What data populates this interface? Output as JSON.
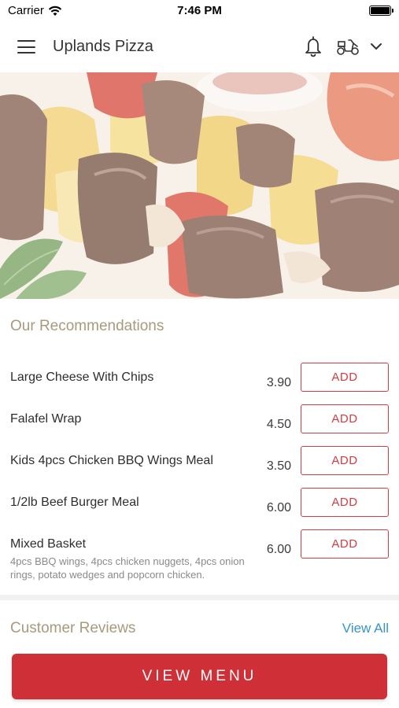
{
  "status_bar": {
    "carrier": "Carrier",
    "time": "7:46 PM"
  },
  "header": {
    "title": "Uplands Pizza",
    "icons": [
      "menu-icon",
      "bell-icon",
      "scooter-icon",
      "chevron-down-icon"
    ]
  },
  "recommendations": {
    "title": "Our Recommendations",
    "add_label": "ADD",
    "items": [
      {
        "name": "Large Cheese With Chips",
        "price": "3.90",
        "description": ""
      },
      {
        "name": "Falafel Wrap",
        "price": "4.50",
        "description": ""
      },
      {
        "name": "Kids 4pcs Chicken BBQ Wings Meal",
        "price": "3.50",
        "description": ""
      },
      {
        "name": "1/2lb Beef Burger Meal",
        "price": "6.00",
        "description": ""
      },
      {
        "name": "Mixed Basket",
        "price": "6.00",
        "description": "4pcs BBQ wings, 4pcs chicken nuggets, 4pcs onion rings, potato wedges and popcorn chicken."
      }
    ]
  },
  "reviews": {
    "title": "Customer Reviews",
    "view_all": "View All"
  },
  "footer": {
    "view_menu": "VIEW MENU"
  },
  "colors": {
    "accent_red": "#cf2f36",
    "section_title": "#a89a7c",
    "link_blue": "#3a93c8"
  }
}
